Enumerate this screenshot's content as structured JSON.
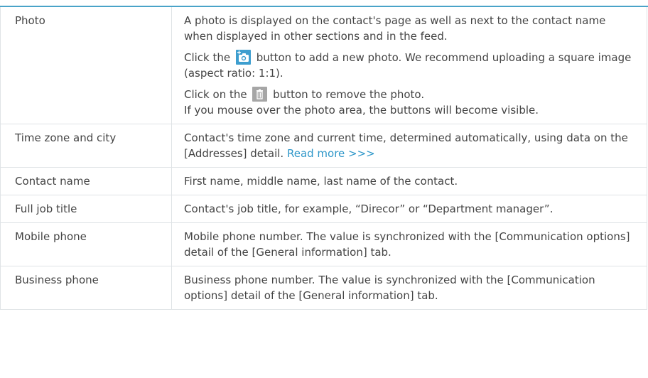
{
  "rows": [
    {
      "name": "Photo",
      "paragraphs": [
        "A photo  is displayed on the contact's page as well as next to the contact name when displayed in other sections and in the feed.",
        "",
        "",
        "If you mouse over the photo area, the buttons will become visible."
      ],
      "add_photo": {
        "before": "Click the",
        "after": "button to add a new photo. We recommend uploading a square image (aspect ratio: 1:1).",
        "icon": "add-photo-icon",
        "color": "#3d9ecf"
      },
      "remove_photo": {
        "before": "Click on the",
        "after": "button to remove the photo.",
        "icon": "trash-icon",
        "color": "#a6a6a6"
      }
    },
    {
      "name": "Time zone and city",
      "text": "Contact's time zone and current time, determined automatically, using data on the [Addresses] detail.",
      "link": "Read more >>>",
      "link_color": "#2f97c9"
    },
    {
      "name": "Contact name",
      "text": "First name, middle name, last name of the contact."
    },
    {
      "name": "Full job title",
      "text": "Contact's job title, for example, “Direcor” or “Department manager”."
    },
    {
      "name": "Mobile phone",
      "text": "Mobile phone number. The value is synchronized with the [Communication options] detail of the [General information] tab."
    },
    {
      "name": "Business phone",
      "text": "Business phone number. The value is synchronized with the [Communication options] detail of the [General information] tab."
    }
  ],
  "colors": {
    "accent_rule": "#4aa3c8",
    "border": "#dfe3e6",
    "text": "#444444"
  }
}
